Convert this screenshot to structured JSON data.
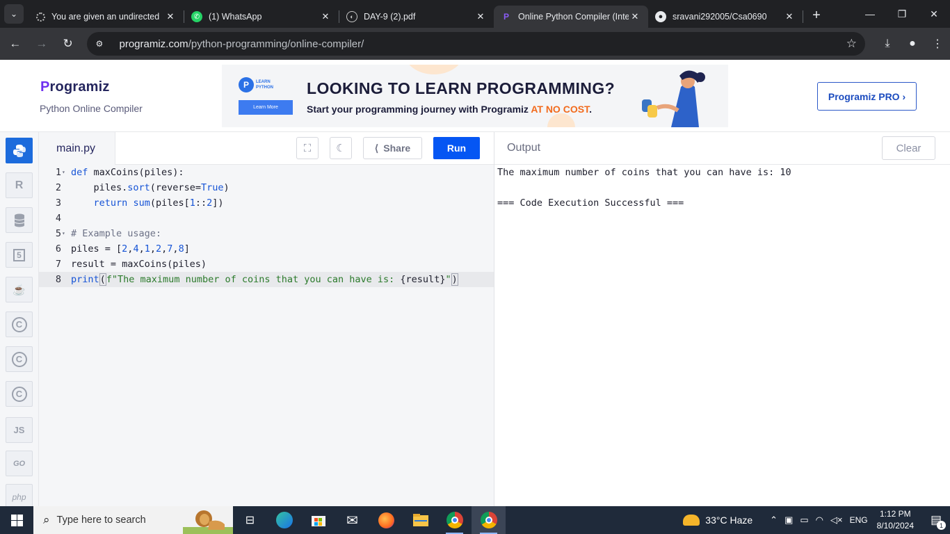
{
  "browser": {
    "tabs": [
      {
        "title": "You are given an undirected",
        "favicon": "openai-icon"
      },
      {
        "title": "(1) WhatsApp",
        "favicon": "whatsapp-icon"
      },
      {
        "title": "DAY-9 (2).pdf",
        "favicon": "globe-icon"
      },
      {
        "title": "Online Python Compiler (Inte",
        "favicon": "programiz-icon",
        "active": true
      },
      {
        "title": "sravani292005/Csa0690",
        "favicon": "github-icon"
      }
    ],
    "url_host": "programiz.com",
    "url_path": "/python-programming/online-compiler/"
  },
  "site": {
    "logo_text": "rogramiz",
    "logo_initial": "P",
    "subtitle": "Python Online Compiler",
    "pro_button": "Programiz PRO ›",
    "banner": {
      "badge_line1": "LEARN",
      "badge_line2": "PYTHON",
      "learn_more": "Learn More",
      "headline": "LOOKING TO LEARN PROGRAMMING?",
      "sub_prefix": "Start your programming journey with Programiz ",
      "sub_highlight": "AT NO COST",
      "sub_suffix": "."
    }
  },
  "languages": [
    {
      "name": "python-icon",
      "label": "",
      "active": true
    },
    {
      "name": "r-icon",
      "label": "R"
    },
    {
      "name": "sql-icon",
      "label": ""
    },
    {
      "name": "html-icon",
      "label": "5"
    },
    {
      "name": "java-icon",
      "label": "☕"
    },
    {
      "name": "c-icon",
      "label": "C"
    },
    {
      "name": "cpp-icon",
      "label": "C"
    },
    {
      "name": "csharp-icon",
      "label": "C"
    },
    {
      "name": "js-icon",
      "label": "JS"
    },
    {
      "name": "go-icon",
      "label": "GO"
    },
    {
      "name": "php-icon",
      "label": "php"
    }
  ],
  "editor": {
    "filename": "main.py",
    "share_label": "Share",
    "run_label": "Run",
    "lines": [
      {
        "n": "1",
        "fold": true
      },
      {
        "n": "2"
      },
      {
        "n": "3"
      },
      {
        "n": "4"
      },
      {
        "n": "5",
        "fold": true
      },
      {
        "n": "6"
      },
      {
        "n": "7"
      },
      {
        "n": "8",
        "current": true
      }
    ],
    "code": {
      "l1a": "def",
      "l1b": " maxCoins(piles):",
      "l2a": "    piles.",
      "l2b": "sort",
      "l2c": "(reverse=",
      "l2d": "True",
      "l2e": ")",
      "l3a": "    ",
      "l3b": "return",
      "l3c": " ",
      "l3d": "sum",
      "l3e": "(piles[",
      "l3f": "1",
      "l3g": "::",
      "l3h": "2",
      "l3i": "])",
      "l5": "# Example usage:",
      "l6a": "piles = [",
      "l6b": "2",
      "l6c": ",",
      "l6d": "4",
      "l6e": ",",
      "l6f": "1",
      "l6g": ",",
      "l6h": "2",
      "l6i": ",",
      "l6j": "7",
      "l6k": ",",
      "l6l": "8",
      "l6m": "]",
      "l7": "result = maxCoins(piles)",
      "l8a": "print",
      "l8b": "(",
      "l8c": "f\"The maximum number of coins that you can have is: ",
      "l8d": "{result}",
      "l8e": "\"",
      "l8f": ")"
    }
  },
  "output": {
    "title": "Output",
    "clear_label": "Clear",
    "lines": [
      "The maximum number of coins that you can have is: 10",
      "",
      "=== Code Execution Successful ==="
    ]
  },
  "taskbar": {
    "search_placeholder": "Type here to search",
    "weather": "33°C  Haze",
    "language": "ENG",
    "time": "1:12 PM",
    "date": "8/10/2024",
    "notifications": "1"
  },
  "colors": {
    "run_button": "#0556f3",
    "active_language": "#1c6bdc",
    "banner_highlight": "#f26b1d",
    "logo_purple": "#6e2ff0"
  }
}
